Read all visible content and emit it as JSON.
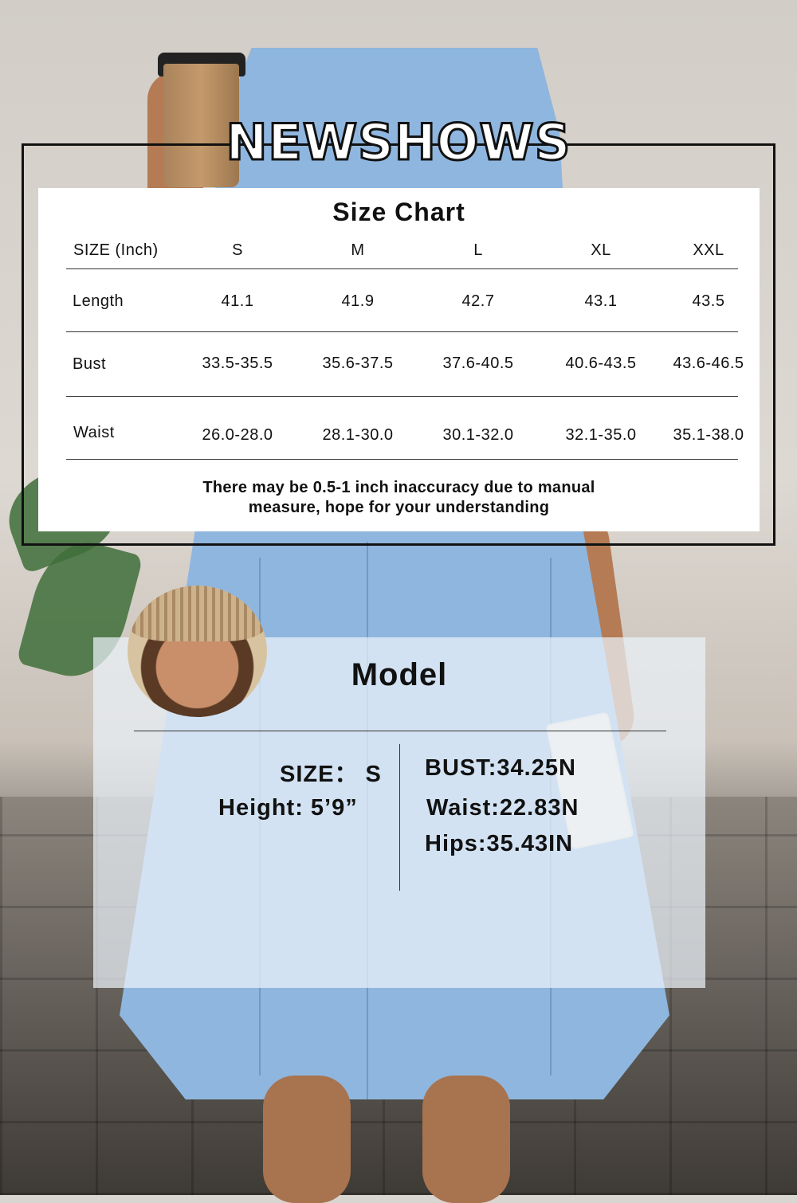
{
  "brand": "NEWSHOWS",
  "size_chart": {
    "title": "Size Chart",
    "header_label": "SIZE (Inch)",
    "sizes": [
      "S",
      "M",
      "L",
      "XL",
      "XXL"
    ],
    "rows": [
      {
        "label": "Length",
        "values": [
          "41.1",
          "41.9",
          "42.7",
          "43.1",
          "43.5"
        ]
      },
      {
        "label": "Bust",
        "values": [
          "33.5-35.5",
          "35.6-37.5",
          "37.6-40.5",
          "40.6-43.5",
          "43.6-46.5"
        ]
      },
      {
        "label": "Waist",
        "values": [
          "26.0-28.0",
          "28.1-30.0",
          "30.1-32.0",
          "32.1-35.0",
          "35.1-38.0"
        ]
      }
    ],
    "note_line1": "There may be 0.5-1 inch inaccuracy due to manual",
    "note_line2": "measure, hope for your understanding"
  },
  "model": {
    "title": "Model",
    "size": "SIZE： S",
    "height": "Height: 5’9”",
    "bust": "BUST:34.25N",
    "waist": "Waist:22.83N",
    "hips": "Hips:35.43IN"
  },
  "colors": {
    "dress": "#8fb6de",
    "card": "#ffffff",
    "text": "#111111"
  }
}
